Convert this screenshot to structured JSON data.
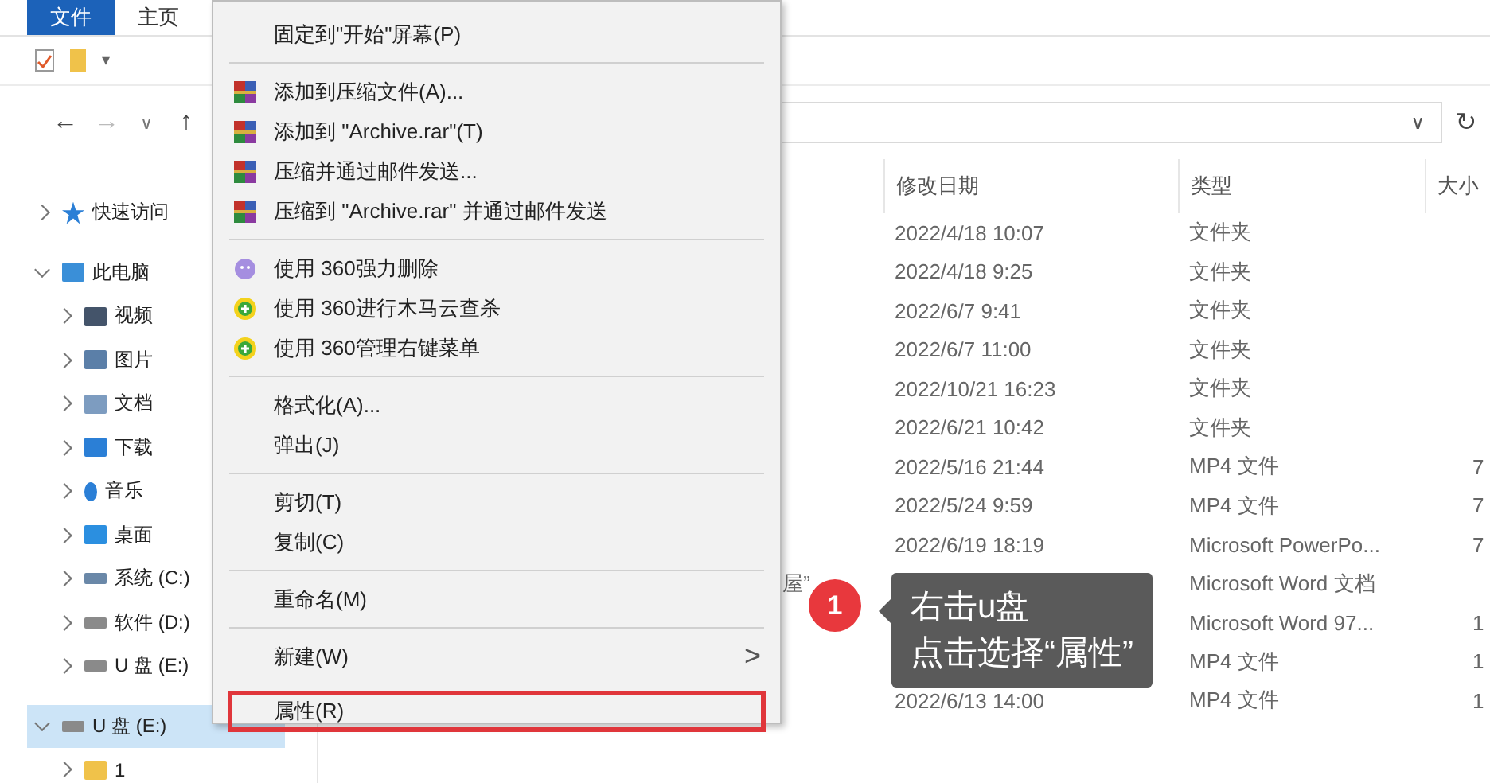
{
  "ribbon_tabs": [
    {
      "label": "文件",
      "selected": true
    },
    {
      "label": "主页",
      "selected": false
    }
  ],
  "quick_toolbar": {
    "dropdown": "▾"
  },
  "nav": {
    "back": "←",
    "forward": "→",
    "recent": "∨",
    "up": "↑",
    "address_dropdown": "∨",
    "refresh": "↻"
  },
  "sidebar": {
    "items": [
      {
        "label": "快速访问",
        "kind": "star",
        "expanded": false,
        "selected": false
      },
      {
        "label": "此电脑",
        "kind": "pc",
        "expanded": true,
        "selected": false,
        "children": [
          {
            "label": "视频",
            "kind": "video",
            "expanded": false,
            "selected": false
          },
          {
            "label": "图片",
            "kind": "picture",
            "expanded": false,
            "selected": false
          },
          {
            "label": "文档",
            "kind": "doc",
            "expanded": false,
            "selected": false
          },
          {
            "label": "下载",
            "kind": "download",
            "expanded": false,
            "selected": false
          },
          {
            "label": "音乐",
            "kind": "music",
            "expanded": false,
            "selected": false
          },
          {
            "label": "桌面",
            "kind": "desktop",
            "expanded": false,
            "selected": false
          },
          {
            "label": "系统 (C:)",
            "kind": "system",
            "expanded": false,
            "selected": false
          },
          {
            "label": "软件 (D:)",
            "kind": "drive",
            "expanded": false,
            "selected": false
          },
          {
            "label": "U 盘 (E:)",
            "kind": "drive",
            "expanded": false,
            "selected": false
          }
        ]
      },
      {
        "label": "U 盘 (E:)",
        "kind": "drive",
        "expanded": true,
        "selected": true,
        "children": [
          {
            "label": "1",
            "kind": "folder",
            "expanded": false,
            "selected": false
          }
        ]
      }
    ]
  },
  "table": {
    "columns": [
      "修改日期",
      "类型",
      "大小"
    ],
    "rows": [
      {
        "date": "2022/4/18 10:07",
        "type": "文件夹"
      },
      {
        "date": "2022/4/18 9:25",
        "type": "文件夹"
      },
      {
        "date": "2022/6/7 9:41",
        "type": "文件夹"
      },
      {
        "date": "2022/6/7 11:00",
        "type": "文件夹"
      },
      {
        "date": "2022/10/21 16:23",
        "type": "文件夹"
      },
      {
        "date": "2022/6/21 10:42",
        "type": "文件夹"
      },
      {
        "date": "2022/5/16 21:44",
        "type": "MP4 文件",
        "size": "7"
      },
      {
        "date": "2022/5/24 9:59",
        "type": "MP4 文件",
        "size": "7"
      },
      {
        "date": "2022/6/19 18:19",
        "type": "Microsoft PowerPo...",
        "size": "7"
      },
      {
        "name": "屋”",
        "type": "Microsoft Word 文档"
      },
      {
        "type": "Microsoft Word 97...",
        "size": "1"
      },
      {
        "type": "MP4 文件",
        "size": "1"
      },
      {
        "date": "2022/6/13 14:00",
        "type": "MP4 文件",
        "size": "1"
      }
    ]
  },
  "context_menu": {
    "items": [
      {
        "kind": "plain",
        "label": "固定到\"开始\"屏幕(P)",
        "selected": false
      },
      {
        "kind": "separator"
      },
      {
        "kind": "archive",
        "label": "添加到压缩文件(A)...",
        "selected": false
      },
      {
        "kind": "archive",
        "label": "添加到 \"Archive.rar\"(T)",
        "selected": false
      },
      {
        "kind": "archive",
        "label": "压缩并通过邮件发送...",
        "selected": false
      },
      {
        "kind": "archive",
        "label": "压缩到 \"Archive.rar\" 并通过邮件发送",
        "selected": false
      },
      {
        "kind": "separator"
      },
      {
        "kind": "shred",
        "label": "使用 360强力删除",
        "selected": false
      },
      {
        "kind": "scan",
        "label": "使用 360进行木马云查杀",
        "selected": false
      },
      {
        "kind": "scan",
        "label": "使用 360管理右键菜单",
        "selected": false
      },
      {
        "kind": "separator"
      },
      {
        "kind": "plain",
        "label": "格式化(A)...",
        "selected": false
      },
      {
        "kind": "plain",
        "label": "弹出(J)",
        "selected": false
      },
      {
        "kind": "separator"
      },
      {
        "kind": "plain",
        "label": "剪切(T)",
        "selected": false
      },
      {
        "kind": "plain",
        "label": "复制(C)",
        "selected": false
      },
      {
        "kind": "separator"
      },
      {
        "kind": "plain",
        "label": "重命名(M)",
        "selected": false
      },
      {
        "kind": "separator"
      },
      {
        "kind": "submenu",
        "label": "新建(W)",
        "arrow": ">",
        "selected": false
      },
      {
        "kind": "plain",
        "label": "属性(R)",
        "selected": true
      }
    ]
  },
  "callout": {
    "step": "1",
    "lines": [
      "右击u盘",
      "点击选择“属性”"
    ]
  }
}
